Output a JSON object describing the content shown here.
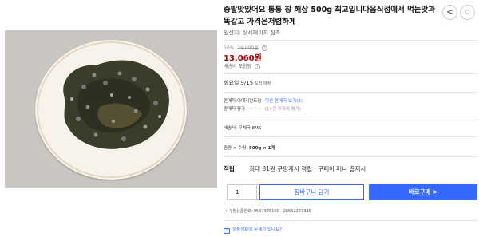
{
  "product": {
    "title": "중발맛있어요 통통 창 해삼 500g 최고입니다음식점에서 먹는맛과 똑같고 가격은저렴하게",
    "origin": "원산지: 상세페이지 참조",
    "image_alt": "plate of sea cucumber"
  },
  "price": {
    "discount_pct": "50%",
    "original": "16,000원",
    "sale": "13,060원",
    "shipping": "배송비 포함됨"
  },
  "arrival": {
    "day": "화요일",
    "date": "9/15",
    "suffix": "도착 예정"
  },
  "seller": {
    "label": "판매자:아메리칸드림",
    "link": "다른 판매자 보기(2)",
    "rating_label": "판매자 평가",
    "rating_count": "(14건 이하의 평가)"
  },
  "delivery": "배송사: 우체국 EMS",
  "option": {
    "label": "중량 × 수량:",
    "value": "500g × 1개"
  },
  "cash": {
    "label": "적립",
    "amount": "최대 81원",
    "link": "쿠팡캐시 적립",
    "suffix": "· 쿠페이 머니 결제시"
  },
  "actions": {
    "quantity": "1",
    "cart": "장바구니 담기",
    "buy": "바로구매 >"
  },
  "product_no": "쿠팡상품번호: 9597976100 - 28652273385",
  "report": "상품정보에 문제가 있나요?",
  "icons": {
    "share": "share-icon",
    "wish": "heart-icon"
  },
  "colors": {
    "accent": "#346aff",
    "sale": "#ae0000"
  }
}
